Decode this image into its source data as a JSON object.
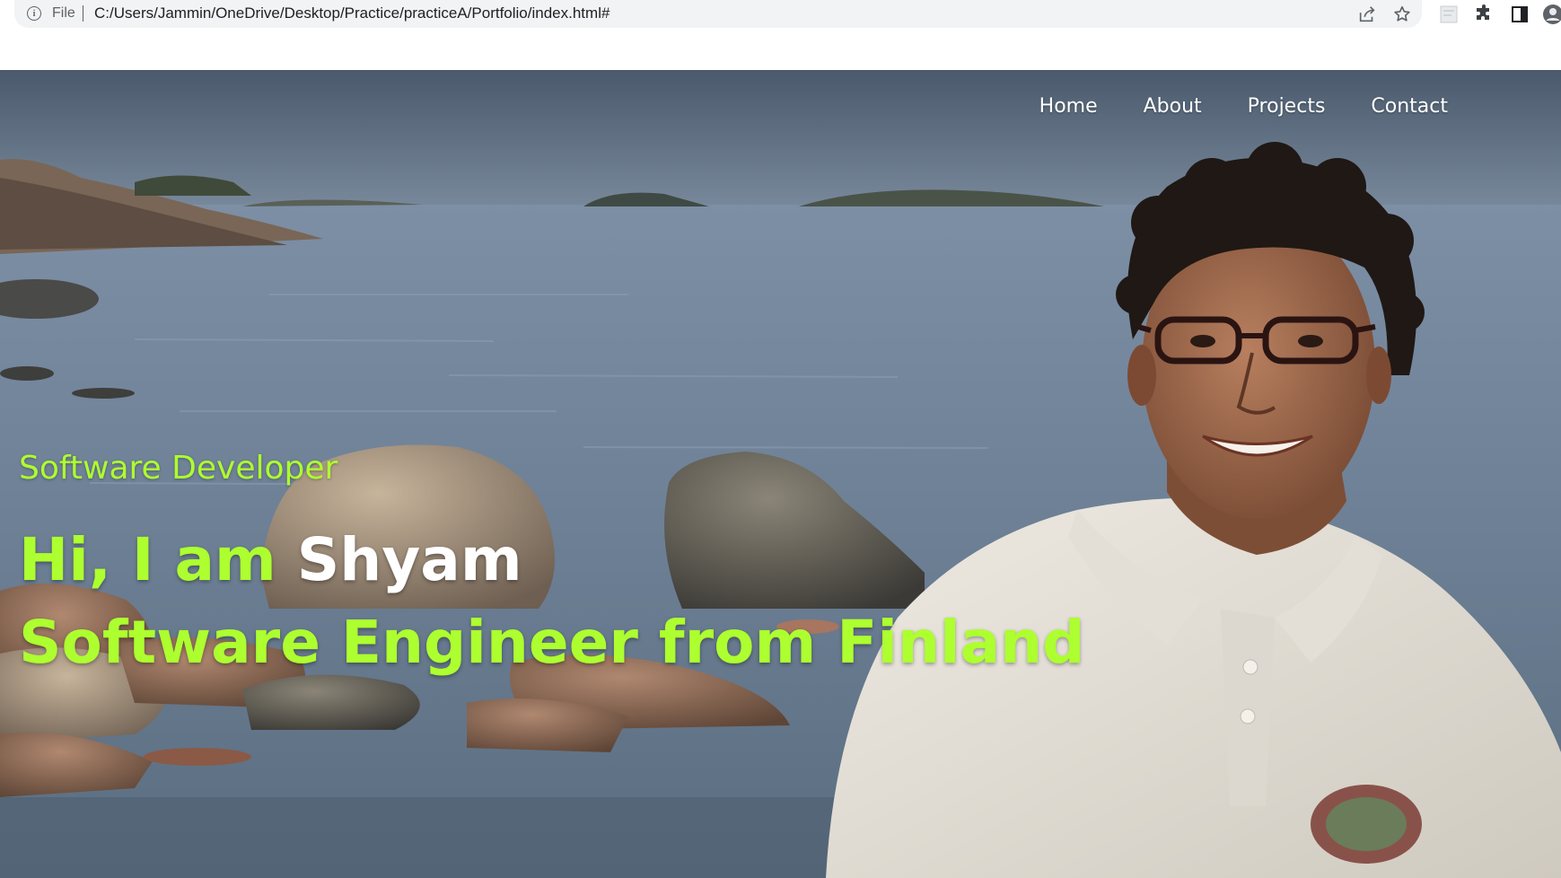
{
  "browser": {
    "scheme_label": "File",
    "url": "C:/Users/Jammin/OneDrive/Desktop/Practice/practiceA/Portfolio/index.html#",
    "icons": [
      "info-icon",
      "share-icon",
      "bookmark-star-icon",
      "extension-thumbnail-icon",
      "puzzle-icon",
      "side-panel-icon",
      "profile-icon"
    ]
  },
  "nav": {
    "items": [
      {
        "label": "Home"
      },
      {
        "label": "About"
      },
      {
        "label": "Projects"
      },
      {
        "label": "Contact"
      }
    ]
  },
  "hero": {
    "role": "Software Developer",
    "greeting": "Hi, I am ",
    "name": "Shyam",
    "tagline": "Software Engineer from Finland",
    "accent_color": "#adff2f",
    "name_color": "#ffffff",
    "background_description_icon": "hero-photo"
  }
}
